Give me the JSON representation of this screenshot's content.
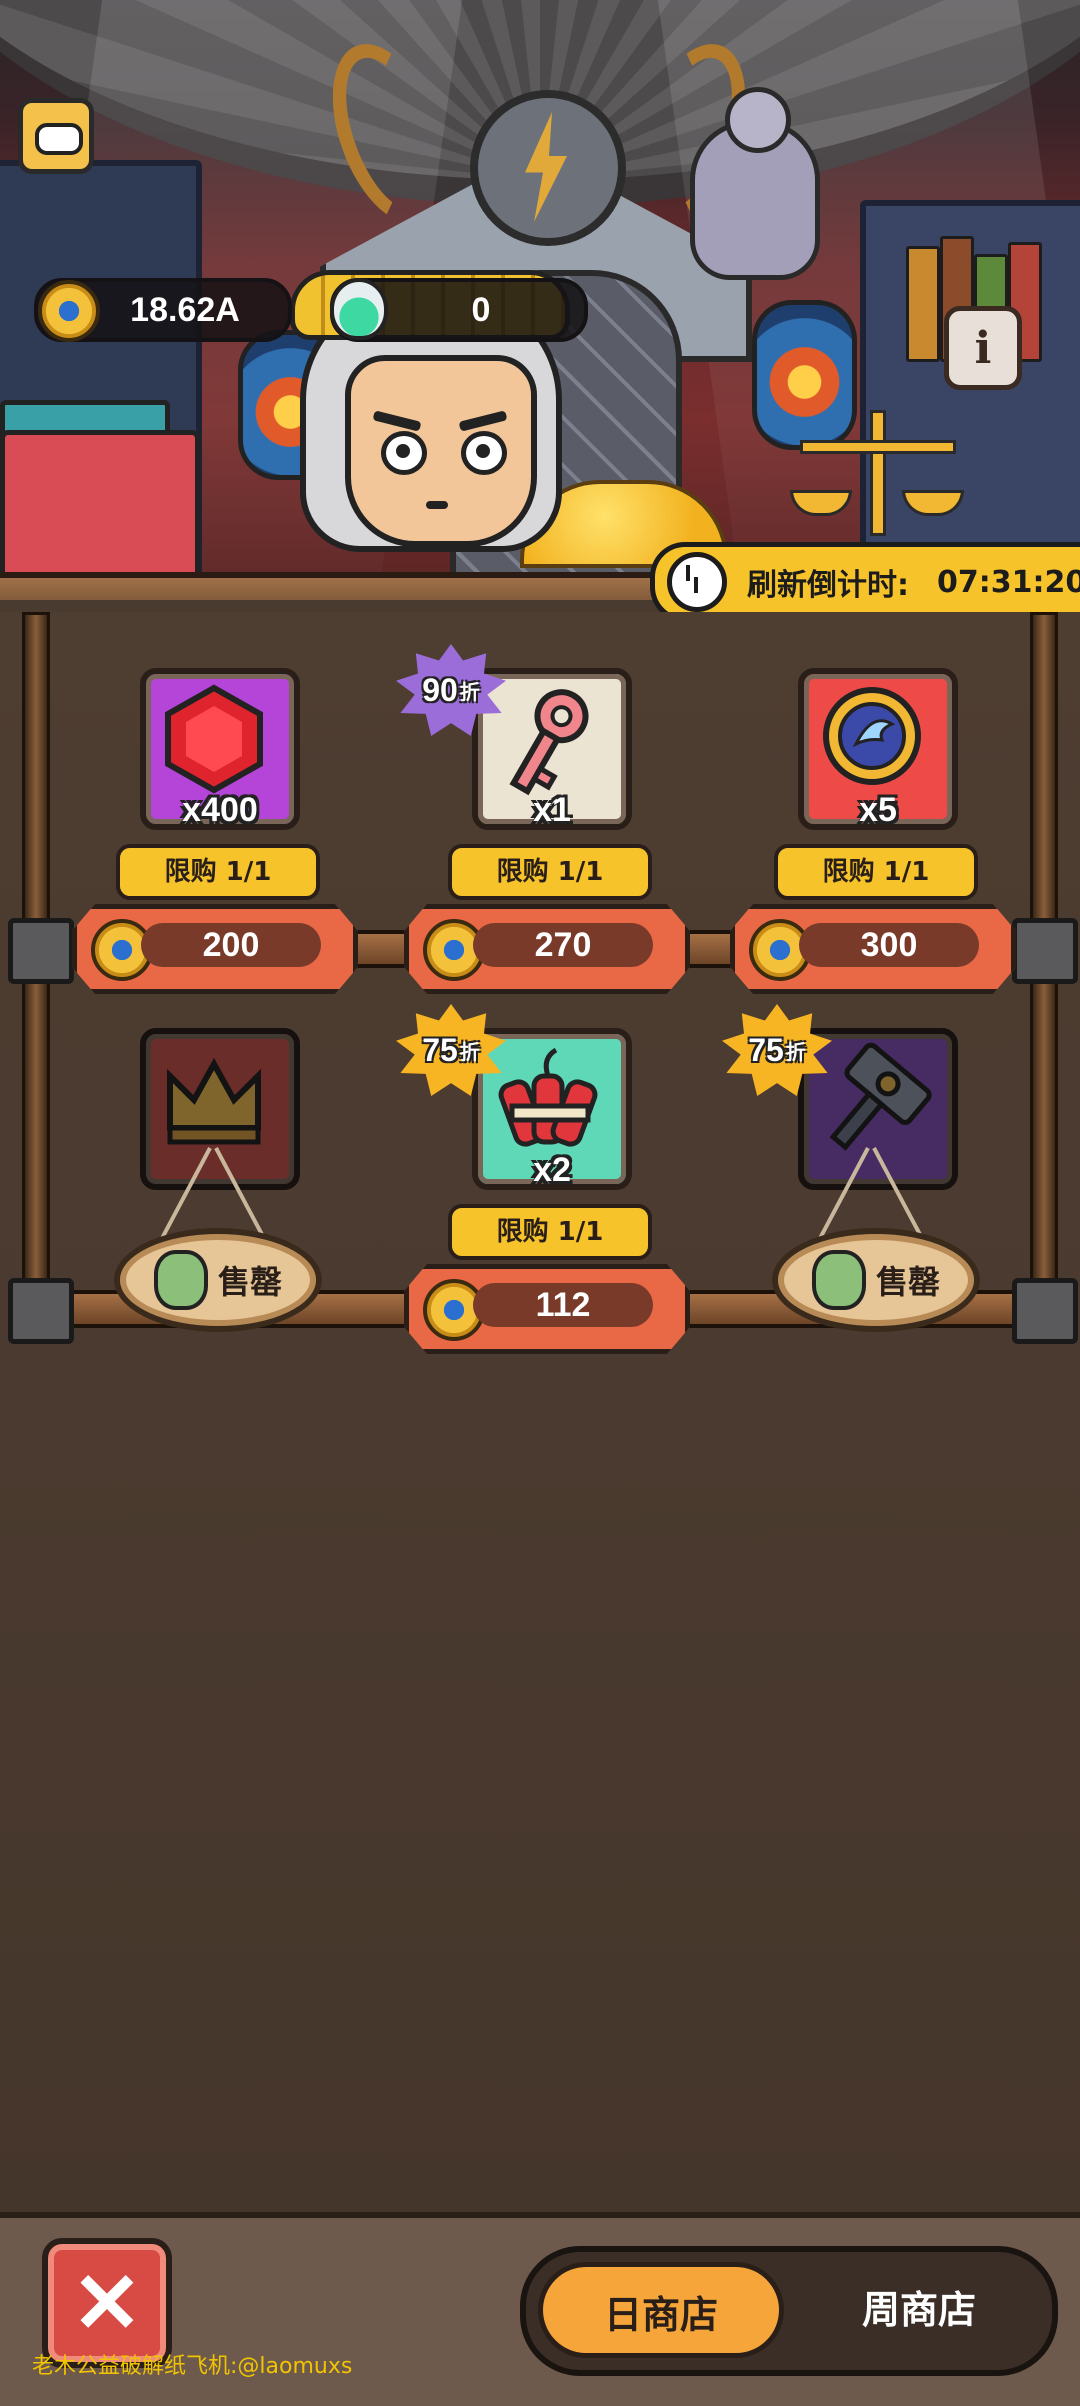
{
  "hud": {
    "coin_amount": "18.62A",
    "potion_amount": "0",
    "info_icon_glyph": "i"
  },
  "refresh": {
    "label": "刷新倒计时:",
    "time": "07:31:20"
  },
  "shop": {
    "row1": [
      {
        "item": "ruby-gem",
        "qty": "x400",
        "limit": "限购 1/1",
        "price": "200",
        "discount": ""
      },
      {
        "item": "red-key",
        "qty": "x1",
        "limit": "限购 1/1",
        "price": "270",
        "discount": "90",
        "discount_suffix": "折"
      },
      {
        "item": "wing-token",
        "qty": "x5",
        "limit": "限购 1/1",
        "price": "300",
        "discount": ""
      }
    ],
    "row2": [
      {
        "item": "crown",
        "sold": "售罄"
      },
      {
        "item": "dynamite",
        "qty": "x2",
        "limit": "限购 1/1",
        "price": "112",
        "discount": "75",
        "discount_suffix": "折"
      },
      {
        "item": "hammer",
        "sold": "售罄",
        "discount": "75",
        "discount_suffix": "折"
      }
    ]
  },
  "bottom": {
    "close_glyph": "✕",
    "tabs": [
      "日商店",
      "周商店"
    ],
    "active_tab": "日商店"
  },
  "watermark": "老木公益破解纸飞机:@laomuxs",
  "colors": {
    "accent_yellow": "#f7c32a",
    "price_orange": "#e96845",
    "background": "#4a3b30"
  }
}
